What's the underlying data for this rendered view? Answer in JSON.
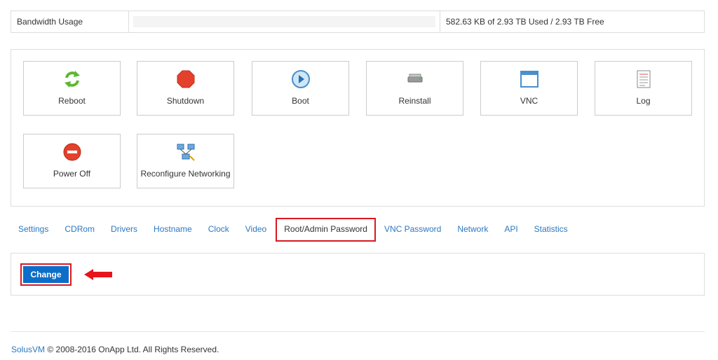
{
  "bandwidth": {
    "label": "Bandwidth Usage",
    "used_fraction": 0.0,
    "value_text": "582.63 KB of 2.93 TB Used / 2.93 TB Free"
  },
  "controls": [
    {
      "label": "Reboot",
      "icon": "reboot-icon"
    },
    {
      "label": "Shutdown",
      "icon": "shutdown-icon"
    },
    {
      "label": "Boot",
      "icon": "boot-icon"
    },
    {
      "label": "Reinstall",
      "icon": "reinstall-icon"
    },
    {
      "label": "VNC",
      "icon": "vnc-icon"
    },
    {
      "label": "Log",
      "icon": "log-icon"
    },
    {
      "label": "Power Off",
      "icon": "power-off-icon"
    },
    {
      "label": "Reconfigure Networking",
      "icon": "network-icon"
    }
  ],
  "tabs": [
    {
      "label": "Settings",
      "active": false
    },
    {
      "label": "CDRom",
      "active": false
    },
    {
      "label": "Drivers",
      "active": false
    },
    {
      "label": "Hostname",
      "active": false
    },
    {
      "label": "Clock",
      "active": false
    },
    {
      "label": "Video",
      "active": false
    },
    {
      "label": "Root/Admin Password",
      "active": true
    },
    {
      "label": "VNC Password",
      "active": false
    },
    {
      "label": "Network",
      "active": false
    },
    {
      "label": "API",
      "active": false
    },
    {
      "label": "Statistics",
      "active": false
    }
  ],
  "change_button": {
    "label": "Change"
  },
  "footer": {
    "brand_link": "SolusVM",
    "copyright": "© 2008-2016 OnApp Ltd. All Rights Reserved."
  },
  "colors": {
    "link": "#2a78c2",
    "highlight": "#d71920",
    "button": "#0c6ec9"
  }
}
